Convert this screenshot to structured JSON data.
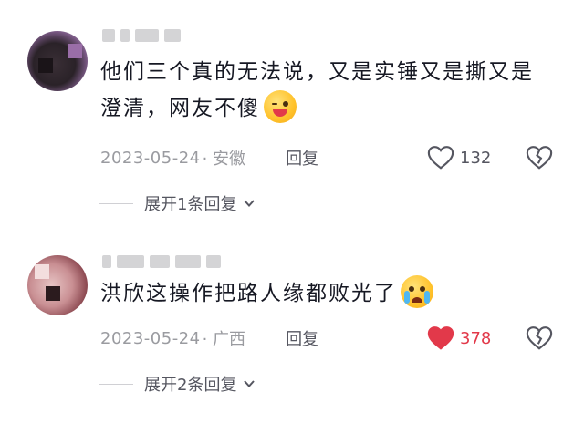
{
  "comments": [
    {
      "username_masked": true,
      "text": "他们三个真的无法说，又是实锤又是撕又是澄清，网友不傻",
      "emoji": "winking-tongue-emoji",
      "date": "2023-05-24",
      "location": "· 安徽",
      "reply_label": "回复",
      "like_count": "132",
      "liked": false,
      "expand_label": "展开1条回复"
    },
    {
      "username_masked": true,
      "text": "洪欣这操作把路人缘都败光了",
      "emoji": "crying-face-emoji",
      "date": "2023-05-24",
      "location": "· 广西",
      "reply_label": "回复",
      "like_count": "378",
      "liked": true,
      "expand_label": "展开2条回复"
    }
  ],
  "colors": {
    "text": "#161823",
    "meta": "#9a9ba0",
    "liked": "#e2394a",
    "icon": "#555660"
  }
}
